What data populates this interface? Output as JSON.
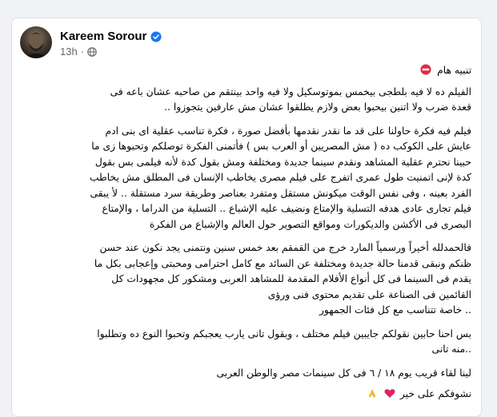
{
  "post": {
    "author": "Kareem Sorour",
    "time": "13h",
    "separator": "·",
    "icons": {
      "verified": "verified-badge-icon",
      "privacy": "globe-icon",
      "warning": "no-entry-icon",
      "heart": "red-heart-icon",
      "pray": "folded-hands-icon"
    },
    "colors": {
      "verified": "#1877f2",
      "warning": "#dd2e44",
      "heart": "#e0245e",
      "meta": "#65676b"
    },
    "warning_title": "تنبيه هام",
    "paragraphs": [
      [
        "الفيلم ده لا فيه بلطجى بيخمس بموتوسكيل ولا فيه واحد بينتقم من صاحبه عشان باعه فى",
        "قعدة ضرب ولا اتنين بيحبوا بعض ولازم يطلقوا عشان مش عارفين يتجوزوا .."
      ],
      [
        "فيلم فيه فكرة حاولنا على قد ما نقدر نقدمها بأفضل صورة ، فكرة تناسب عقلية اى بنى ادم",
        "عايش على الكوكب ده ( مش المصريين أو العرب بس ) فأتمنى الفكرة توصلكم وتحبوها  زى ما",
        "حبينا نحترم عقلية المشاهد ونقدم سينما جديدة ومختلفة ومش بقول كدة لأنه فيلمى بس بقول",
        "كدة لإنى اتمنيت طول عمرى اتفرج على فيلم مصرى يخاطب الإنسان فى المطلق مش يخاطب",
        "الفرد بعينه ، وفى نفس الوقت ميكونش مستقل ومتفرد بعناصر وطريقة سرد مستقلة .. لأ يبقى",
        "فيلم تجارى عادى هدفه التسلية والإمتاع ونضيف عليه الإشباع .. التسلية من الدراما ، والإمتاع",
        "البصرى فى الأكشن والديكورات ومواقع التصوير حول العالم والإشباع من الفكرة"
      ],
      [
        "فالحمدلله أخيراً ورسمياً المارد خرج من القمقم بعد خمس سنين ونتمنى يجد نكون عند حسن",
        "ظنكم ونبقى قدمنا حالة جديدة ومختلفة عن السائد مع كامل احترامى ومحبتى وإعجابى بكل ما",
        "يقدم فى السينما فى كل أنواع الأفلام المقدمة للمشاهد العربى ومشكور كل مجهودات كل",
        "القائمين فى الصناعة على تقديم محتوى فنى ورؤى",
        ".. خاصة تتناسب مع كل فئات الجمهور"
      ],
      [
        "بس احنا حابين نقولكم جايبين فيلم مختلف ، وبقول تانى يارب يعجبكم وتحبوا النوع ده وتطلبوا",
        "..منه تانى"
      ]
    ],
    "release_line": "لينا لقاء قريب يوم ١٨ / ٦ فى كل سينمات مصر والوطن العربى",
    "signoff": "نشوفكم على خير"
  }
}
